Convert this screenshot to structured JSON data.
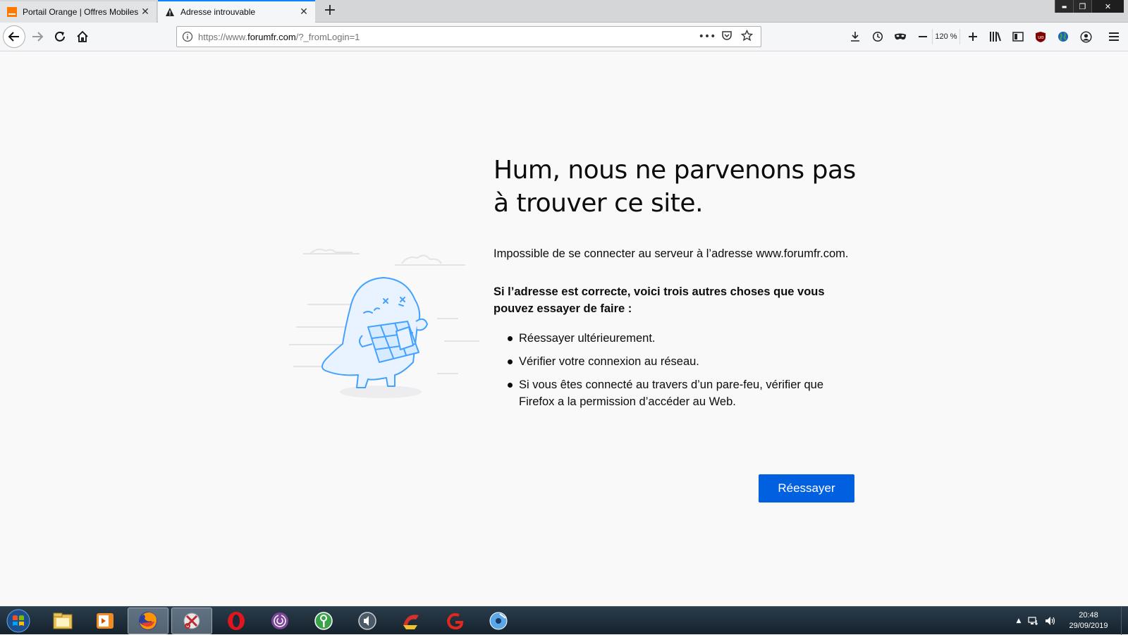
{
  "browser": {
    "tabs": [
      {
        "title": "Portail Orange | Offres Mobiles",
        "favicon": "orange-favicon",
        "close": "✕"
      },
      {
        "title": "Adresse introuvable",
        "favicon": "warning-icon",
        "close": "✕"
      }
    ],
    "new_tab": "+",
    "window_controls": {
      "minimize": "▬",
      "restore": "❐",
      "close": "✕"
    },
    "url": {
      "prefix": "https://www.",
      "host": "forumfr.com",
      "path": "/?_fromLogin=1"
    },
    "zoom": "120 %"
  },
  "error_page": {
    "title": "Hum, nous ne parvenons pas à trouver ce site.",
    "description": "Impossible de se connecter au serveur à l’adresse www.forumfr.com.",
    "suggestions_heading": "Si l’adresse est correcte, voici trois autres choses que vous pouvez essayer de faire :",
    "suggestions": [
      "Réessayer ultérieurement.",
      "Vérifier votre connexion au réseau.",
      "Si vous êtes connecté au travers d’un pare-feu, vérifier que Firefox a la permission d’accéder au Web."
    ],
    "retry_button": "Réessayer"
  },
  "taskbar": {
    "time": "20:48",
    "date": "29/09/2019",
    "apps": [
      "explorer-icon",
      "media-player-icon",
      "firefox-icon",
      "snipping-tool-icon",
      "opera-icon",
      "tor-icon",
      "keepass-icon",
      "audio-icon",
      "ccleaner-icon",
      "aol-icon",
      "dvd-icon"
    ]
  },
  "colors": {
    "accent": "#0060df",
    "tab_highlight": "#0a84ff",
    "illustration": "#45a1ff"
  }
}
